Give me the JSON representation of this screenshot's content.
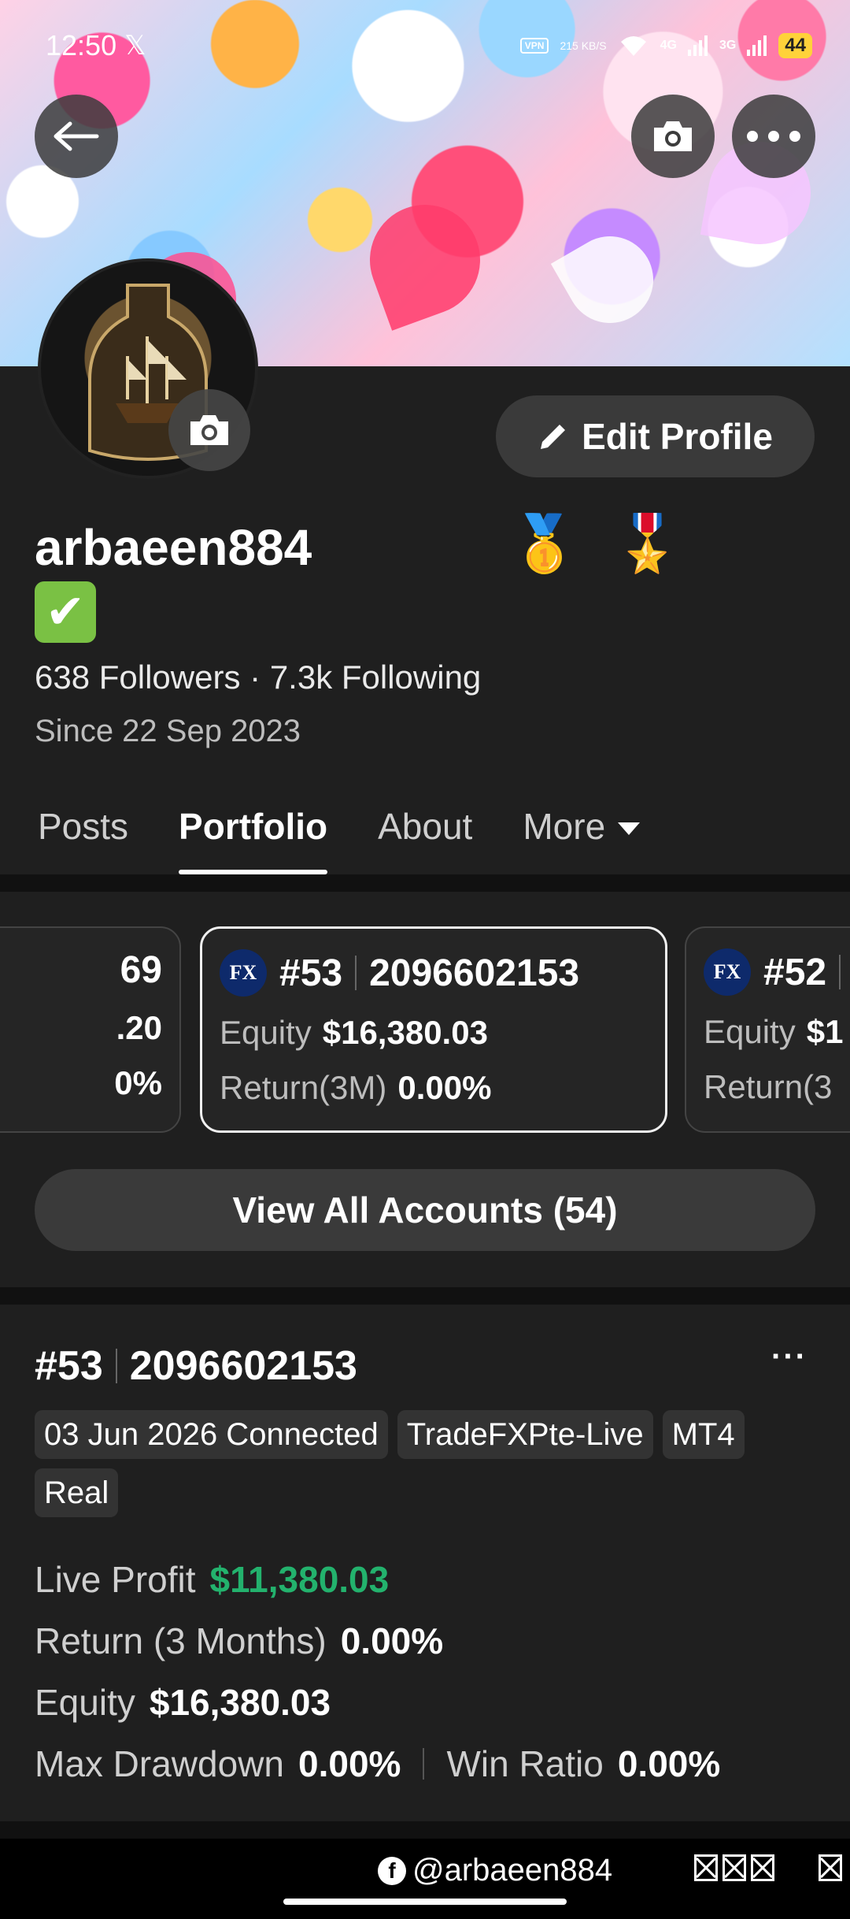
{
  "status_bar": {
    "time": "12:50",
    "x_glyph": "𝕏",
    "vpn": "VPN",
    "speed": "215 KB/S",
    "net1": "4G",
    "net2": "3G",
    "battery": "44"
  },
  "header": {
    "back_icon": "arrow-left-icon",
    "camera_icon": "camera-icon",
    "more_icon": "more-dots-icon"
  },
  "profile": {
    "edit_label": "Edit Profile",
    "username": "arbaeen884",
    "medals": [
      "🥇",
      "🎖️"
    ],
    "verified": "✔",
    "followers": "638 Followers",
    "dot": "·",
    "following": "7.3k Following",
    "since": "Since 22 Sep 2023"
  },
  "tabs": [
    {
      "label": "Posts",
      "active": false
    },
    {
      "label": "Portfolio",
      "active": true
    },
    {
      "label": "About",
      "active": false
    },
    {
      "label": "More",
      "active": false
    }
  ],
  "accounts": [
    {
      "id": "69",
      "equity_value": ".20",
      "return_value": "0%"
    },
    {
      "logo": "FX",
      "rank": "#53",
      "number": "2096602153",
      "equity_label": "Equity",
      "equity_value": "$16,380.03",
      "return_label": "Return(3M)",
      "return_value": "0.00%"
    },
    {
      "logo": "FX",
      "rank": "#52",
      "equity_label": "Equity",
      "equity_value": "$1",
      "return_label": "Return(3"
    }
  ],
  "view_all_label": "View All Accounts (54)",
  "detail": {
    "rank": "#53",
    "number": "2096602153",
    "more_label": "···",
    "chips": [
      "03 Jun 2026 Connected",
      "TradeFXPte-Live",
      "MT4",
      "Real"
    ],
    "live_profit_label": "Live Profit",
    "live_profit_value": "$11,380.03",
    "return_label": "Return (3 Months)",
    "return_value": "0.00%",
    "equity_label": "Equity",
    "equity_value": "$16,380.03",
    "drawdown_label": "Max Drawdown",
    "drawdown_value": "0.00%",
    "win_label": "Win Ratio",
    "win_value": "0.00%"
  },
  "footer": {
    "fb_letter": "f",
    "handle": "@arbaeen884"
  },
  "colors": {
    "background": "#1f1f1f",
    "profit_green": "#23b26d",
    "battery": "#ffd23a"
  }
}
